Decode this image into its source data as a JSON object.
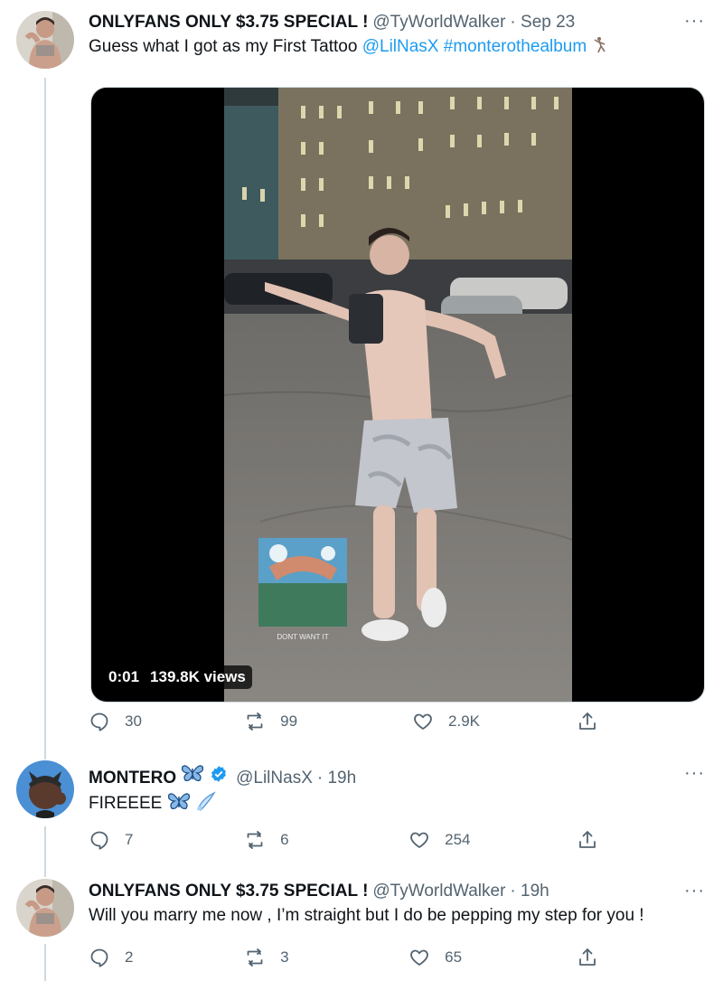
{
  "tweets": [
    {
      "name": "ONLYFANS ONLY $3.75 SPECIAL !",
      "handle": "@TyWorldWalker",
      "time": "· Sep 23",
      "text_plain": "Guess what I got as my First Tattoo ",
      "mention": "@LilNasX",
      "hashtag": "#monterothealbum",
      "video_time": "0:01",
      "video_views": "139.8K views",
      "album_caption": "DONT WANT IT",
      "replies": "30",
      "retweets": "99",
      "likes": "2.9K"
    },
    {
      "name": "MONTERO",
      "handle": "@LilNasX",
      "time": "· 19h",
      "text": "FIREEEE",
      "replies": "7",
      "retweets": "6",
      "likes": "254"
    },
    {
      "name": "ONLYFANS ONLY $3.75 SPECIAL !",
      "handle": "@TyWorldWalker",
      "time": "· 19h",
      "text": "Will you marry me now , I’m straight but I do be pepping my step for you !",
      "replies": "2",
      "retweets": "3",
      "likes": "65"
    }
  ],
  "more_label": "···",
  "colors": {
    "link": "#1d9bf0",
    "muted": "#536471",
    "verified": "#1d9bf0",
    "divider": "#cfd9de"
  },
  "icons": [
    "reply-icon",
    "retweet-icon",
    "like-icon",
    "share-icon",
    "more-icon",
    "verified-icon",
    "butterfly-icon",
    "comet-icon",
    "dancer-icon"
  ]
}
